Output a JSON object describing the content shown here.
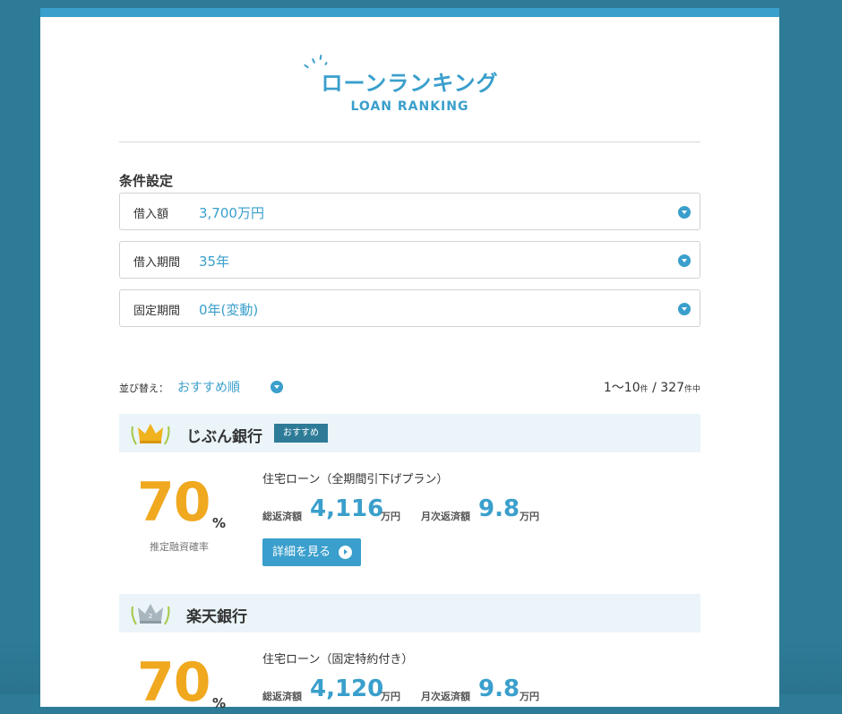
{
  "header": {
    "title_jp": "ローンランキング",
    "title_en": "LOAN RANKING"
  },
  "conditions": {
    "title": "条件設定",
    "fields": [
      {
        "label": "借入額",
        "value": "3,700万円"
      },
      {
        "label": "借入期間",
        "value": "35年"
      },
      {
        "label": "固定期間",
        "value": "0年(変動)"
      }
    ]
  },
  "sort": {
    "label": "並び替え：",
    "value": "おすすめ順"
  },
  "count": {
    "range": "1〜10",
    "range_unit": "件",
    "sep": "/",
    "total": "327",
    "total_unit": "件中"
  },
  "rankings": [
    {
      "rank": "1",
      "bank": "じぶん銀行",
      "badge": "おすすめ",
      "rate": "70",
      "rate_unit": "%",
      "rate_caption": "推定融資確率",
      "plan": "住宅ローン（全期間引下げプラン）",
      "total_label": "総返済額",
      "total_value": "4,116",
      "total_unit": "万円",
      "monthly_label": "月次返済額",
      "monthly_value": "9.8",
      "monthly_unit": "万円",
      "button": "詳細を見る"
    },
    {
      "rank": "2",
      "bank": "楽天銀行",
      "rate": "70",
      "rate_unit": "%",
      "plan": "住宅ローン（固定特約付き）",
      "total_label": "総返済額",
      "total_value": "4,120",
      "total_unit": "万円",
      "monthly_label": "月次返済額",
      "monthly_value": "9.8",
      "monthly_unit": "万円"
    }
  ],
  "colors": {
    "background": "#2d7b97",
    "accent": "#3a9fcc",
    "rate": "#f0a81f",
    "bank_bar": "#eaf4f9",
    "badge": "#2d7b97"
  },
  "icons": [
    "sparkle-icon",
    "chevron-down-icon",
    "gold-crown-icon",
    "silver-crown-icon",
    "arrow-right-circle-icon"
  ]
}
